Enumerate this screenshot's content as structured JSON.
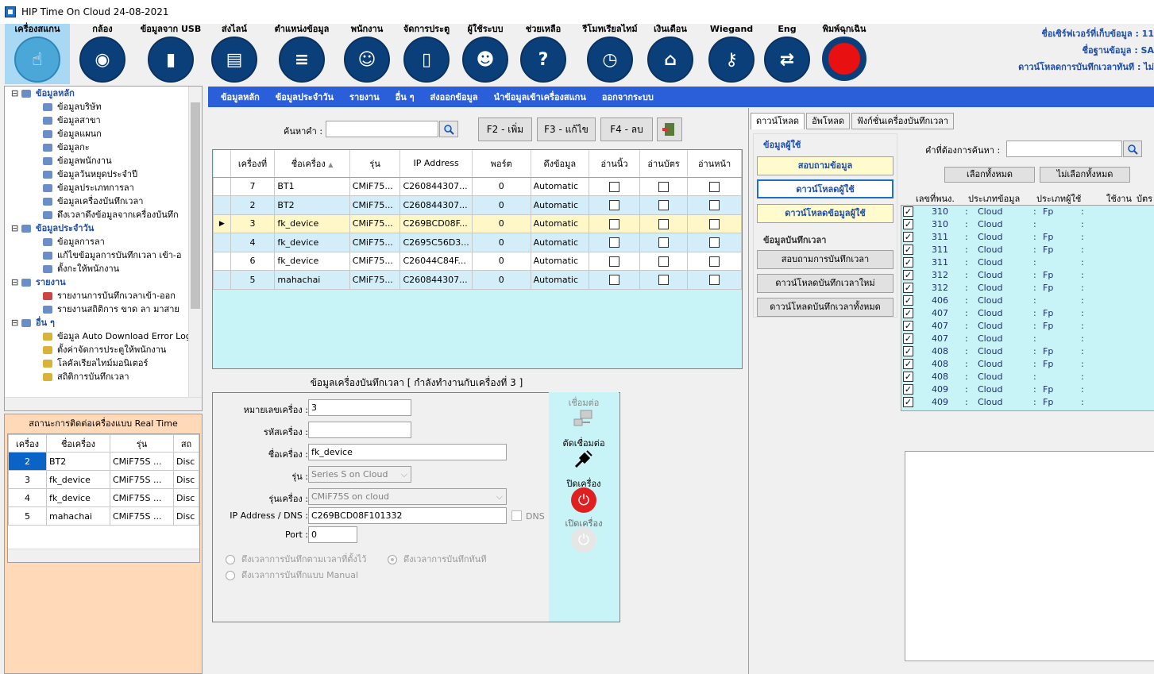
{
  "window": {
    "title": "HIP Time On Cloud 24-08-2021"
  },
  "toolbar": [
    {
      "label": "เครื่องสแกน",
      "glyph": "☝"
    },
    {
      "label": "กล้อง",
      "glyph": "◉"
    },
    {
      "label": "ข้อมูลจาก USB",
      "glyph": "▮"
    },
    {
      "label": "ส่งไลน์",
      "glyph": "▤"
    },
    {
      "label": "ตำแหน่งข้อมูล",
      "glyph": "≡"
    },
    {
      "label": "พนักงาน",
      "glyph": "☺"
    },
    {
      "label": "จัดการประตู",
      "glyph": "▯"
    },
    {
      "label": "ผู้ใช้ระบบ",
      "glyph": "☻"
    },
    {
      "label": "ช่วยเหลือ",
      "glyph": "?"
    },
    {
      "label": "รีโมทเรียลไทม์",
      "glyph": "◷"
    },
    {
      "label": "เงินเดือน",
      "glyph": "⌂"
    },
    {
      "label": "Wiegand",
      "glyph": "⚷"
    },
    {
      "label": "Eng",
      "glyph": "⇄"
    },
    {
      "label": "พิมพ์ฉุกเฉิน",
      "glyph": ""
    }
  ],
  "server": {
    "line1": "ชื่อเซิร์ฟเวอร์ที่เก็บข้อมูล : 11",
    "line2": "ชื่อฐานข้อมูล : SA",
    "line3": "ดาวน์โหลดการบันทึกเวลาทันที : ไม่"
  },
  "tree": {
    "groups": [
      {
        "label": "ข้อมูลหลัก",
        "items": [
          "ข้อมูลบริษัท",
          "ข้อมูลสาขา",
          "ข้อมูลแผนก",
          "ข้อมูลกะ",
          "ข้อมูลพนักงาน",
          "ข้อมูลวันหยุดประจำปี",
          "ข้อมูลประเภทการลา",
          "ข้อมูลเครื่องบันทึกเวลา",
          "ดึงเวลาดึงข้อมูลจากเครื่องบันทึก"
        ]
      },
      {
        "label": "ข้อมูลประจำวัน",
        "items": [
          "ข้อมูลการลา",
          "แก้ไขข้อมูลการบันทึกเวลา เข้า-อ",
          "ตั้งกะให้พนักงาน"
        ]
      },
      {
        "label": "รายงาน",
        "items": [
          "รายงานการบันทึกเวลาเข้า-ออก",
          "รายงานสถิติการ ขาด ลา มาสาย"
        ]
      },
      {
        "label": "อื่น ๆ",
        "items": [
          "ข้อมูล Auto Download Error Log",
          "ตั้งค่าจัดการประตูให้พนักงาน",
          "โลคัลเรียลไทม์มอนิเตอร์",
          "สถิติการบันทึกเวลา"
        ]
      }
    ]
  },
  "realtime": {
    "title": "สถานะการติดต่อเครื่องแบบ Real Time",
    "headers": [
      "เครื่อง",
      "ชื่อเครื่อง",
      "รุ่น",
      "สถ"
    ],
    "rows": [
      [
        "2",
        "BT2",
        "CMiF75S ...",
        "Disc"
      ],
      [
        "3",
        "fk_device",
        "CMiF75S ...",
        "Disc"
      ],
      [
        "4",
        "fk_device",
        "CMiF75S ...",
        "Disc"
      ],
      [
        "5",
        "mahachai",
        "CMiF75S ...",
        "Disc"
      ]
    ]
  },
  "menu": [
    "ข้อมูลหลัก",
    "ข้อมูลประจำวัน",
    "รายงาน",
    "อื่น ๆ",
    "ส่งออกข้อมูล",
    "นำข้อมูลเข้าเครื่องสแกน",
    "ออกจากระบบ"
  ],
  "search": {
    "label": "ค้นหาคำ :",
    "value": ""
  },
  "fbuttons": [
    "F2 - เพิ่ม",
    "F3 - แก้ไข",
    "F4 - ลบ"
  ],
  "grid": {
    "headers": [
      "เครื่องที่",
      "ชื่อเครื่อง",
      "รุ่น",
      "IP Address",
      "พอร์ต",
      "ดึงข้อมูล",
      "อ่านนิ้ว",
      "อ่านบัตร",
      "อ่านหน้า"
    ],
    "rows": [
      [
        "7",
        "BT1",
        "CMiF75...",
        "C260844307...",
        "0",
        "Automatic"
      ],
      [
        "2",
        "BT2",
        "CMiF75...",
        "C260844307...",
        "0",
        "Automatic"
      ],
      [
        "3",
        "fk_device",
        "CMiF75...",
        "C269BCD08F...",
        "0",
        "Automatic"
      ],
      [
        "4",
        "fk_device",
        "CMiF75...",
        "C2695C56D3...",
        "0",
        "Automatic"
      ],
      [
        "6",
        "fk_device",
        "CMiF75...",
        "C26044C84F...",
        "0",
        "Automatic"
      ],
      [
        "5",
        "mahachai",
        "CMiF75...",
        "C260844307...",
        "0",
        "Automatic"
      ]
    ]
  },
  "detail": {
    "title": "ข้อมูลเครื่องบันทึกเวลา [ กำลังทำงานกับเครื่องที่ 3 ]",
    "labels": {
      "no": "หมายเลขเครื่อง :",
      "code": "รหัสเครื่อง :",
      "name": "ชื่อเครื่อง :",
      "series": "รุ่น :",
      "model": "รุ่นเครื่อง :",
      "ip": "IP Address / DNS :",
      "port": "Port :"
    },
    "values": {
      "no": "3",
      "code": "",
      "name": "fk_device",
      "series": "Series S on Cloud",
      "model": "CMiF75S  on cloud",
      "ip": "C269BCD08F101332",
      "port": "0"
    },
    "dns": "DNS",
    "radio1": "ดึงเวลาการบันทึกตามเวลาที่ตั้งไว้",
    "radio2": "ดึงเวลาการบันทึกทันที",
    "radio3": "ดึงเวลาการบันทึกแบบ Manual",
    "connect": "เชื่อมต่อ",
    "disconnect": "ตัดเชื่อมต่อ",
    "poweroff": "ปิดเครื่อง",
    "poweron": "เปิดเครื่อง"
  },
  "right": {
    "tabs": [
      "ดาวน์โหลด",
      "อัพโหลด",
      "ฟังก์ชั่นเครื่องบันทึกเวลา"
    ],
    "user_header": "ข้อมูลผู้ใช้",
    "user_btns": [
      "สอบถามข้อมูล",
      "ดาวน์โหลดผู้ใช้",
      "ดาวน์โหลดข้อมูลผู้ใช้"
    ],
    "time_header": "ข้อมูลบันทึกเวลา",
    "time_btns": [
      "สอบถามการบันทึกเวลา",
      "ดาวน์โหลดบันทึกเวลาใหม่",
      "ดาวน์โหลดบันทึกเวลาทั้งหมด"
    ],
    "search_label": "คำที่ต้องการค้นหา :",
    "select_all": "เลือกทั้งหมด",
    "deselect_all": "ไม่เลือกทั้งหมด",
    "list_headers": [
      "เลขที่พนง.",
      "ประเภทข้อมูล",
      "ประเภทผู้ใช้",
      "ใช้งาน",
      "บัตร"
    ],
    "list": [
      [
        "310",
        "Cloud",
        "Fp"
      ],
      [
        "310",
        "Cloud",
        ""
      ],
      [
        "311",
        "Cloud",
        "Fp"
      ],
      [
        "311",
        "Cloud",
        "Fp"
      ],
      [
        "311",
        "Cloud",
        ""
      ],
      [
        "312",
        "Cloud",
        "Fp"
      ],
      [
        "312",
        "Cloud",
        "Fp"
      ],
      [
        "406",
        "Cloud",
        ""
      ],
      [
        "407",
        "Cloud",
        "Fp"
      ],
      [
        "407",
        "Cloud",
        "Fp"
      ],
      [
        "407",
        "Cloud",
        ""
      ],
      [
        "408",
        "Cloud",
        "Fp"
      ],
      [
        "408",
        "Cloud",
        "Fp"
      ],
      [
        "408",
        "Cloud",
        ""
      ],
      [
        "409",
        "Cloud",
        "Fp"
      ],
      [
        "409",
        "Cloud",
        "Fp"
      ]
    ]
  }
}
